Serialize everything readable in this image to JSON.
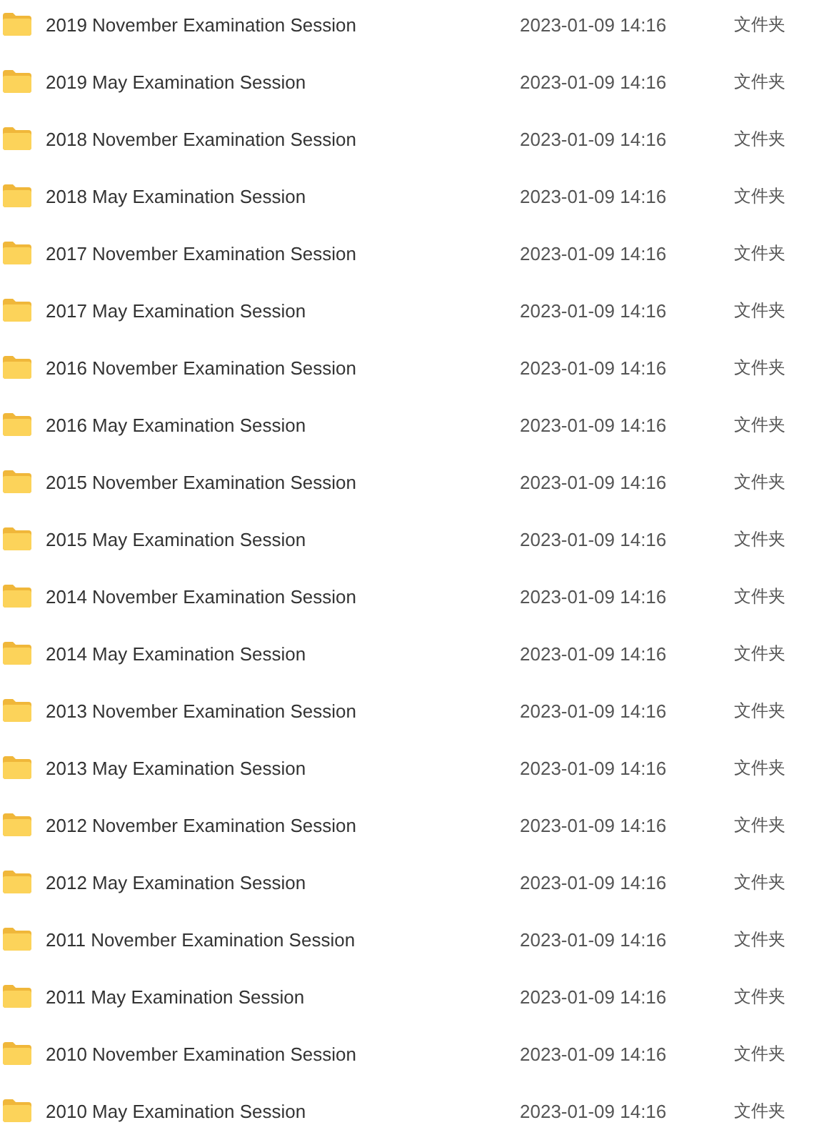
{
  "files": [
    {
      "name": "2019 November Examination Session",
      "modified": "2023-01-09 14:16",
      "type": "文件夹"
    },
    {
      "name": "2019 May Examination Session",
      "modified": "2023-01-09 14:16",
      "type": "文件夹"
    },
    {
      "name": "2018 November Examination Session",
      "modified": "2023-01-09 14:16",
      "type": "文件夹"
    },
    {
      "name": "2018 May Examination Session",
      "modified": "2023-01-09 14:16",
      "type": "文件夹"
    },
    {
      "name": "2017 November Examination Session",
      "modified": "2023-01-09 14:16",
      "type": "文件夹"
    },
    {
      "name": "2017 May Examination Session",
      "modified": "2023-01-09 14:16",
      "type": "文件夹"
    },
    {
      "name": "2016 November Examination Session",
      "modified": "2023-01-09 14:16",
      "type": "文件夹"
    },
    {
      "name": "2016 May Examination Session",
      "modified": "2023-01-09 14:16",
      "type": "文件夹"
    },
    {
      "name": "2015 November Examination Session",
      "modified": "2023-01-09 14:16",
      "type": "文件夹"
    },
    {
      "name": "2015 May Examination Session",
      "modified": "2023-01-09 14:16",
      "type": "文件夹"
    },
    {
      "name": "2014 November Examination Session",
      "modified": "2023-01-09 14:16",
      "type": "文件夹"
    },
    {
      "name": "2014 May Examination Session",
      "modified": "2023-01-09 14:16",
      "type": "文件夹"
    },
    {
      "name": "2013 November Examination Session",
      "modified": "2023-01-09 14:16",
      "type": "文件夹"
    },
    {
      "name": "2013 May Examination Session",
      "modified": "2023-01-09 14:16",
      "type": "文件夹"
    },
    {
      "name": "2012 November Examination Session",
      "modified": "2023-01-09 14:16",
      "type": "文件夹"
    },
    {
      "name": "2012 May Examination Session",
      "modified": "2023-01-09 14:16",
      "type": "文件夹"
    },
    {
      "name": "2011 November Examination Session",
      "modified": "2023-01-09 14:16",
      "type": "文件夹"
    },
    {
      "name": "2011 May Examination Session",
      "modified": "2023-01-09 14:16",
      "type": "文件夹"
    },
    {
      "name": "2010 November Examination Session",
      "modified": "2023-01-09 14:16",
      "type": "文件夹"
    },
    {
      "name": "2010 May Examination Session",
      "modified": "2023-01-09 14:16",
      "type": "文件夹"
    }
  ]
}
